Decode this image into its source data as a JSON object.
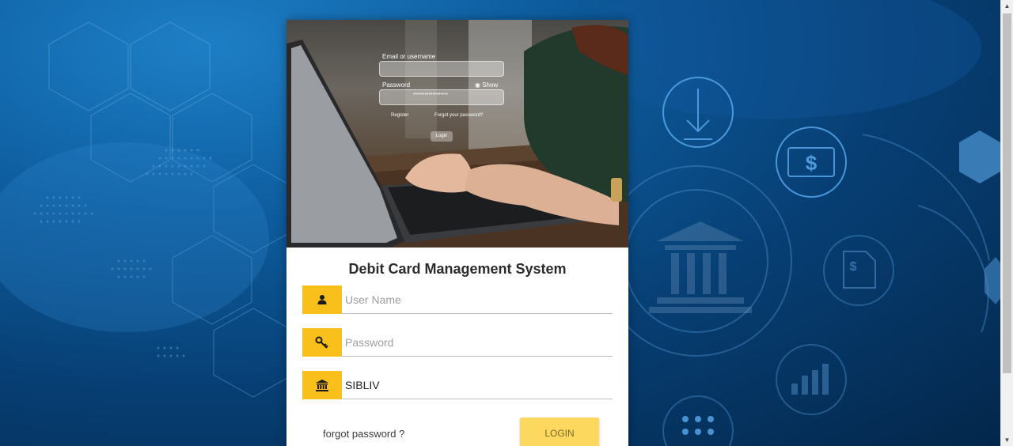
{
  "app": {
    "title": "Debit Card Management System"
  },
  "hero_image": {
    "mock_email_label": "Email or username",
    "mock_password_label": "Password",
    "mock_show_label": "Show",
    "mock_register_label": "Register",
    "mock_forgot_label": "Forgot your password?",
    "mock_login_label": "Login",
    "mock_password_mask": "••••••••••••••••••"
  },
  "form": {
    "username": {
      "placeholder": "User Name",
      "value": "",
      "icon": "user-icon"
    },
    "password": {
      "placeholder": "Password",
      "value": "",
      "icon": "key-icon"
    },
    "bank": {
      "value": "SIBLIV",
      "icon": "bank-icon"
    }
  },
  "actions": {
    "forgot_label": "forgot password ?",
    "login_label": "LOGIN"
  },
  "colors": {
    "accent": "#f9bf1a",
    "login_button": "#fcd85e",
    "background_dark": "#03264a",
    "background_light": "#1e7fc6"
  }
}
